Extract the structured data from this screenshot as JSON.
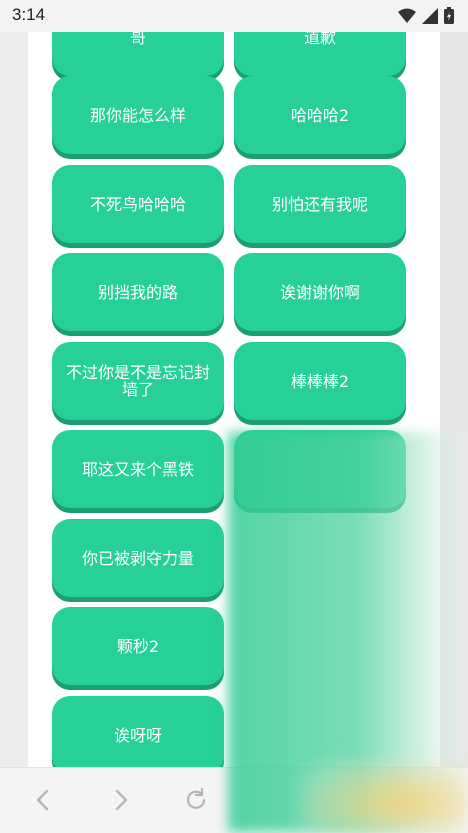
{
  "status": {
    "time": "3:14"
  },
  "buttons": [
    {
      "label": "哥"
    },
    {
      "label": "道歉"
    },
    {
      "label": "那你能怎么样"
    },
    {
      "label": "哈哈哈2"
    },
    {
      "label": "不死鸟哈哈哈"
    },
    {
      "label": "别怕还有我呢"
    },
    {
      "label": "别挡我的路"
    },
    {
      "label": "诶谢谢你啊"
    },
    {
      "label": "不过你是不是忘记封墙了"
    },
    {
      "label": "棒棒棒2"
    },
    {
      "label": "耶这又来个黑铁"
    },
    {
      "label": ""
    },
    {
      "label": "你已被剥夺力量"
    },
    {
      "label": "颗秒2"
    },
    {
      "label": "诶呀呀"
    }
  ],
  "colors": {
    "button": "#27d095",
    "button_shadow": "#1b9e70"
  },
  "nav": {
    "icons": [
      "back-icon",
      "forward-icon",
      "reload-icon"
    ]
  }
}
